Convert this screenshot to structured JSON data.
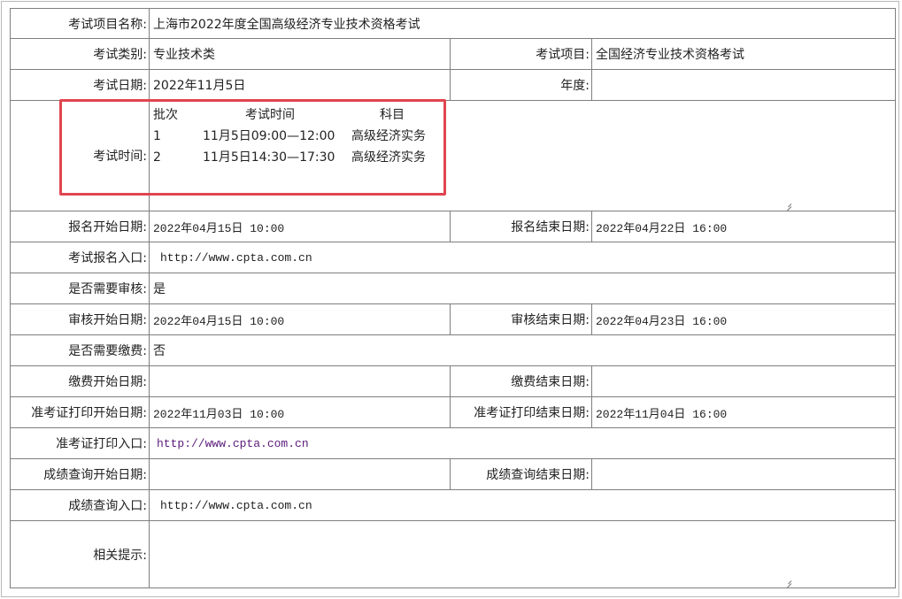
{
  "form": {
    "exam_name": {
      "label": "考试项目名称:",
      "value": "上海市2022年度全国高级经济专业技术资格考试"
    },
    "category": {
      "label": "考试类别:",
      "value": "专业技术类"
    },
    "project": {
      "label": "考试项目:",
      "value": "全国经济专业技术资格考试"
    },
    "exam_date": {
      "label": "考试日期:",
      "value": "2022年11月5日"
    },
    "year": {
      "label": "年度:",
      "value": ""
    },
    "exam_time": {
      "label": "考试时间:",
      "headers": [
        "批次",
        "考试时间",
        "科目"
      ],
      "rows": [
        {
          "batch": "1",
          "time": "11月5日09:00—12:00",
          "subject": "高级经济实务"
        },
        {
          "batch": "2",
          "time": "11月5日14:30—17:30",
          "subject": "高级经济实务"
        }
      ]
    },
    "reg_start": {
      "label": "报名开始日期:",
      "value": "2022年04月15日 10:00"
    },
    "reg_end": {
      "label": "报名结束日期:",
      "value": "2022年04月22日 16:00"
    },
    "reg_entry": {
      "label": "考试报名入口:",
      "value": "http://www.cpta.com.cn"
    },
    "need_review": {
      "label": "是否需要审核:",
      "value": "是"
    },
    "review_start": {
      "label": "审核开始日期:",
      "value": "2022年04月15日 10:00"
    },
    "review_end": {
      "label": "审核结束日期:",
      "value": "2022年04月23日 16:00"
    },
    "need_fee": {
      "label": "是否需要缴费:",
      "value": "否"
    },
    "fee_start": {
      "label": "缴费开始日期:",
      "value": ""
    },
    "fee_end": {
      "label": "缴费结束日期:",
      "value": ""
    },
    "admit_start": {
      "label": "准考证打印开始日期:",
      "value": "2022年11月03日 10:00"
    },
    "admit_end": {
      "label": "准考证打印结束日期:",
      "value": "2022年11月04日 16:00"
    },
    "admit_entry": {
      "label": "准考证打印入口:",
      "value": "http://www.cpta.com.cn"
    },
    "score_start": {
      "label": "成绩查询开始日期:",
      "value": ""
    },
    "score_end": {
      "label": "成绩查询结束日期:",
      "value": ""
    },
    "score_entry": {
      "label": "成绩查询入口:",
      "value": "http://www.cpta.com.cn"
    },
    "tips": {
      "label": "相关提示:",
      "value": ""
    }
  },
  "colors": {
    "highlight_box": "#e0454f",
    "link_visited": "#5a1a7a",
    "grid": "#7f7f7f"
  }
}
